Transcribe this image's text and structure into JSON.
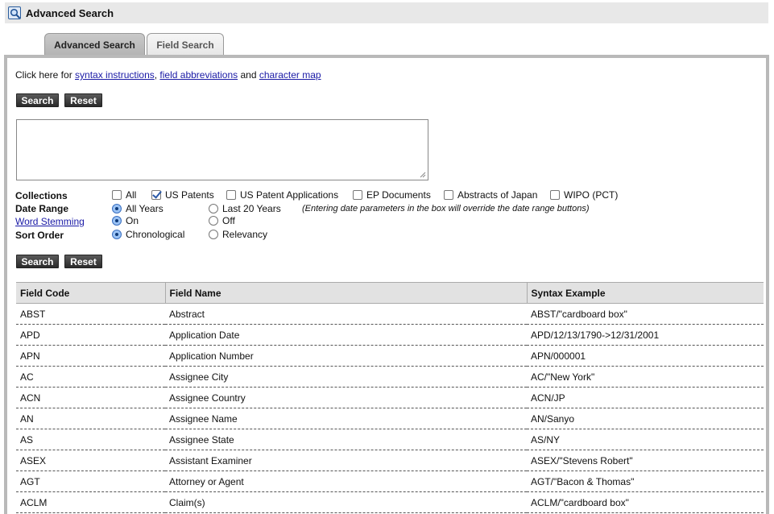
{
  "header": {
    "title": "Advanced Search",
    "icon": "magnifier-icon"
  },
  "tabs": [
    {
      "label": "Advanced Search",
      "active": true
    },
    {
      "label": "Field Search",
      "active": false
    }
  ],
  "intro": {
    "prefix": "Click here for ",
    "link_syntax": "syntax instructions",
    "sep1": ", ",
    "link_fields": "field abbreviations",
    "sep2": " and ",
    "link_charmap": "character map"
  },
  "buttons": {
    "search": "Search",
    "reset": "Reset"
  },
  "query": {
    "value": ""
  },
  "collections": {
    "label": "Collections",
    "items": [
      {
        "label": "All",
        "checked": false
      },
      {
        "label": "US Patents",
        "checked": true
      },
      {
        "label": "US Patent Applications",
        "checked": false
      },
      {
        "label": "EP Documents",
        "checked": false
      },
      {
        "label": "Abstracts of Japan",
        "checked": false
      },
      {
        "label": "WIPO (PCT)",
        "checked": false
      }
    ]
  },
  "date_range": {
    "label": "Date Range",
    "options": [
      {
        "label": "All Years",
        "checked": true
      },
      {
        "label": "Last 20 Years",
        "checked": false
      }
    ],
    "note": "(Entering date parameters in the box will override the date range buttons)"
  },
  "word_stemming": {
    "label": "Word Stemming",
    "options": [
      {
        "label": "On",
        "checked": true
      },
      {
        "label": "Off",
        "checked": false
      }
    ]
  },
  "sort_order": {
    "label": "Sort Order",
    "options": [
      {
        "label": "Chronological",
        "checked": true
      },
      {
        "label": "Relevancy",
        "checked": false
      }
    ]
  },
  "table": {
    "headers": [
      "Field Code",
      "Field Name",
      "Syntax Example"
    ],
    "rows": [
      [
        "ABST",
        "Abstract",
        "ABST/\"cardboard box\""
      ],
      [
        "APD",
        "Application Date",
        "APD/12/13/1790->12/31/2001"
      ],
      [
        "APN",
        "Application Number",
        "APN/000001"
      ],
      [
        "AC",
        "Assignee City",
        "AC/\"New York\""
      ],
      [
        "ACN",
        "Assignee Country",
        "ACN/JP"
      ],
      [
        "AN",
        "Assignee Name",
        "AN/Sanyo"
      ],
      [
        "AS",
        "Assignee State",
        "AS/NY"
      ],
      [
        "ASEX",
        "Assistant Examiner",
        "ASEX/\"Stevens Robert\""
      ],
      [
        "AGT",
        "Attorney or Agent",
        "AGT/\"Bacon & Thomas\""
      ],
      [
        "ACLM",
        "Claim(s)",
        "ACLM/\"cardboard box\""
      ]
    ]
  }
}
